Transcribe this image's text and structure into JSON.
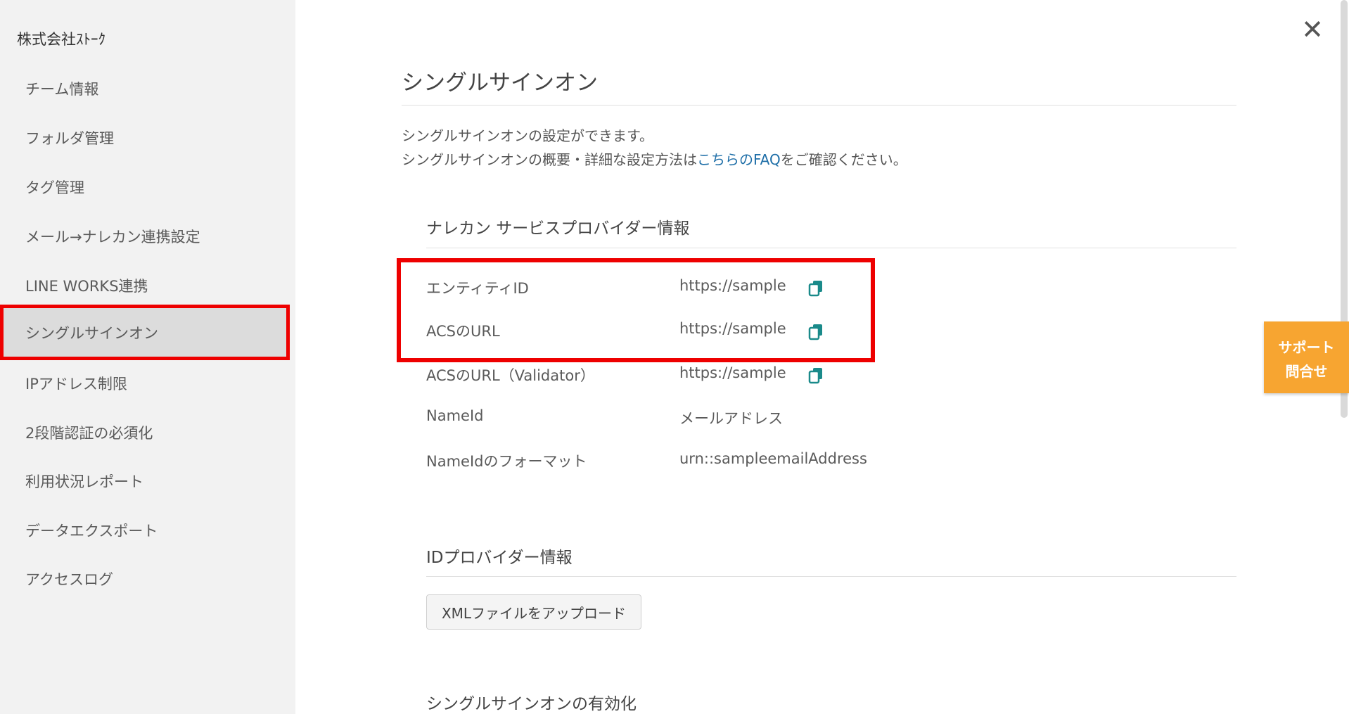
{
  "sidebar": {
    "company_name": "株式会社ｽﾄｰｸ",
    "items": [
      {
        "label": "チーム情報"
      },
      {
        "label": "フォルダ管理"
      },
      {
        "label": "タグ管理"
      },
      {
        "label": "メール→ナレカン連携設定"
      },
      {
        "label": "LINE WORKS連携"
      },
      {
        "label": "シングルサインオン",
        "active": true
      },
      {
        "label": "IPアドレス制限"
      },
      {
        "label": "2段階認証の必須化"
      },
      {
        "label": "利用状況レポート"
      },
      {
        "label": "データエクスポート"
      },
      {
        "label": "アクセスログ"
      }
    ]
  },
  "main": {
    "close_icon": "close-icon",
    "title": "シングルサインオン",
    "intro_line1": "シングルサインオンの設定ができます。",
    "intro_line2_prefix": "シングルサインオンの概要・詳細な設定方法は",
    "intro_line2_link": "こちらのFAQ",
    "intro_line2_suffix": "をご確認ください。",
    "sp_section": {
      "title": "ナレカン サービスプロバイダー情報",
      "rows": [
        {
          "label": "エンティティID",
          "value": "https://sample",
          "copy_icon": "copy-icon"
        },
        {
          "label": "ACSのURL",
          "value": "https://sample",
          "copy_icon": "copy-icon"
        },
        {
          "label": "ACSのURL（Validator）",
          "value": "https://sample",
          "copy_icon": "copy-icon"
        },
        {
          "label": "NameId",
          "value": "メールアドレス"
        },
        {
          "label": "NameIdのフォーマット",
          "value": "urn::sampleemailAddress"
        }
      ]
    },
    "idp_section": {
      "title": "IDプロバイダー情報",
      "upload_label": "XMLファイルをアップロード"
    },
    "enable_section": {
      "title": "シングルサインオンの有効化"
    }
  },
  "support": {
    "line1": "サポート",
    "line2": "問合せ"
  },
  "colors": {
    "accent_link": "#1f6fa8",
    "copy_icon": "#1a8a8a",
    "highlight": "#ee0000",
    "support_button": "#f7a531"
  }
}
